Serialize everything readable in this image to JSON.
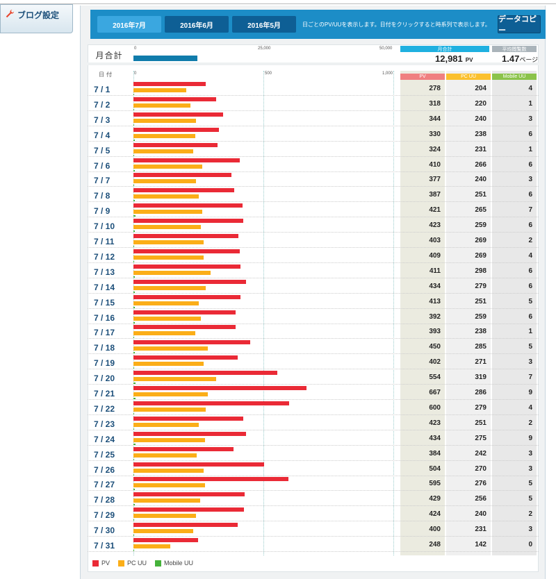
{
  "sidebar": {
    "blog_settings": "ブログ設定"
  },
  "months": [
    {
      "label": "2016年7月",
      "active": true
    },
    {
      "label": "2016年6月",
      "active": false
    },
    {
      "label": "2016年5月",
      "active": false
    }
  ],
  "month_note": "日ごとのPV/UUを表示します。日付をクリックすると時系列で表示します。",
  "copy_button": "データコピー",
  "summary": {
    "label": "月合計",
    "ticks": [
      "0",
      "25,000",
      "50,000"
    ],
    "total_pv_header": "月合計",
    "total_pv": "12,981",
    "pv_unit": "PV",
    "pages_header": "平均閲覧数",
    "pages_value": "1.47",
    "pages_unit": "ページ",
    "monthly_pv_value": 12981
  },
  "table": {
    "date_header": "日付",
    "ticks": [
      "0",
      "500",
      "1,000"
    ],
    "pv_header": "PV",
    "pc_header": "PC UU",
    "mobile_header": "Mobile UU",
    "rows": [
      {
        "date": "7 / 1",
        "pv": "278",
        "pc": "204",
        "mob": "4"
      },
      {
        "date": "7 / 2",
        "pv": "318",
        "pc": "220",
        "mob": "1"
      },
      {
        "date": "7 / 3",
        "pv": "344",
        "pc": "240",
        "mob": "3"
      },
      {
        "date": "7 / 4",
        "pv": "330",
        "pc": "238",
        "mob": "6"
      },
      {
        "date": "7 / 5",
        "pv": "324",
        "pc": "231",
        "mob": "1"
      },
      {
        "date": "7 / 6",
        "pv": "410",
        "pc": "266",
        "mob": "6"
      },
      {
        "date": "7 / 7",
        "pv": "377",
        "pc": "240",
        "mob": "3"
      },
      {
        "date": "7 / 8",
        "pv": "387",
        "pc": "251",
        "mob": "6"
      },
      {
        "date": "7 / 9",
        "pv": "421",
        "pc": "265",
        "mob": "7"
      },
      {
        "date": "7 / 10",
        "pv": "423",
        "pc": "259",
        "mob": "6"
      },
      {
        "date": "7 / 11",
        "pv": "403",
        "pc": "269",
        "mob": "2"
      },
      {
        "date": "7 / 12",
        "pv": "409",
        "pc": "269",
        "mob": "4"
      },
      {
        "date": "7 / 13",
        "pv": "411",
        "pc": "298",
        "mob": "6"
      },
      {
        "date": "7 / 14",
        "pv": "434",
        "pc": "279",
        "mob": "6"
      },
      {
        "date": "7 / 15",
        "pv": "413",
        "pc": "251",
        "mob": "5"
      },
      {
        "date": "7 / 16",
        "pv": "392",
        "pc": "259",
        "mob": "6"
      },
      {
        "date": "7 / 17",
        "pv": "393",
        "pc": "238",
        "mob": "1"
      },
      {
        "date": "7 / 18",
        "pv": "450",
        "pc": "285",
        "mob": "5"
      },
      {
        "date": "7 / 19",
        "pv": "402",
        "pc": "271",
        "mob": "3"
      },
      {
        "date": "7 / 20",
        "pv": "554",
        "pc": "319",
        "mob": "7"
      },
      {
        "date": "7 / 21",
        "pv": "667",
        "pc": "286",
        "mob": "9"
      },
      {
        "date": "7 / 22",
        "pv": "600",
        "pc": "279",
        "mob": "4"
      },
      {
        "date": "7 / 23",
        "pv": "423",
        "pc": "251",
        "mob": "2"
      },
      {
        "date": "7 / 24",
        "pv": "434",
        "pc": "275",
        "mob": "9"
      },
      {
        "date": "7 / 25",
        "pv": "384",
        "pc": "242",
        "mob": "3"
      },
      {
        "date": "7 / 26",
        "pv": "504",
        "pc": "270",
        "mob": "3"
      },
      {
        "date": "7 / 27",
        "pv": "595",
        "pc": "276",
        "mob": "5"
      },
      {
        "date": "7 / 28",
        "pv": "429",
        "pc": "256",
        "mob": "5"
      },
      {
        "date": "7 / 29",
        "pv": "424",
        "pc": "240",
        "mob": "2"
      },
      {
        "date": "7 / 30",
        "pv": "400",
        "pc": "231",
        "mob": "3"
      },
      {
        "date": "7 / 31",
        "pv": "248",
        "pc": "142",
        "mob": "0"
      }
    ]
  },
  "legend": [
    {
      "label": "PV",
      "color": "#ea2a36"
    },
    {
      "label": "PC UU",
      "color": "#fbae18"
    },
    {
      "label": "Mobile UU",
      "color": "#45b23a"
    }
  ],
  "colors": {
    "accent": "#1c8dc7",
    "pv": "#ea2a36",
    "pc": "#fbae18",
    "mobile": "#45b23a",
    "pv_header": "#f08080",
    "pc_header": "#fbc02d",
    "mobile_header": "#8bc34a",
    "total_header": "#1fb0e0",
    "pages_header": "#aab4ba"
  }
}
